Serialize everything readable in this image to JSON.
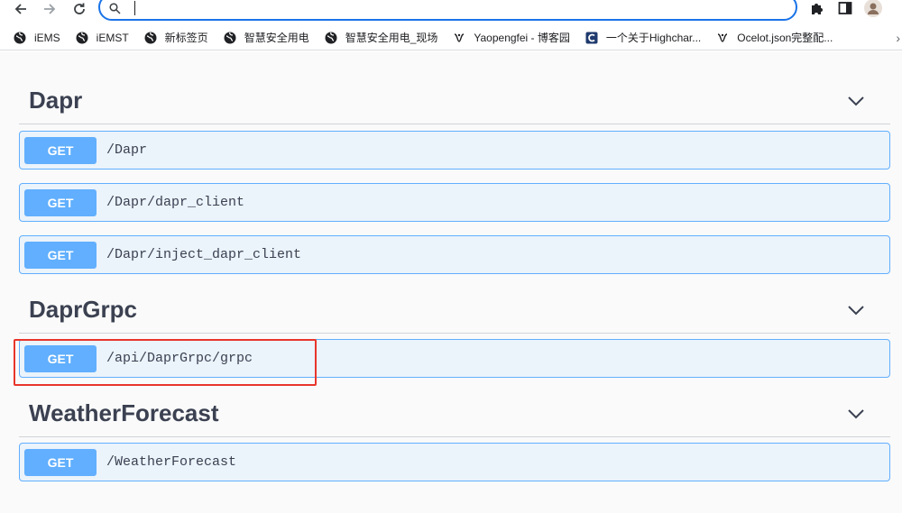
{
  "browser": {
    "address_value": "",
    "bookmarks": [
      {
        "label": "iEMS",
        "icon": "globe-icon"
      },
      {
        "label": "iEMST",
        "icon": "globe-icon"
      },
      {
        "label": "新标签页",
        "icon": "globe-icon"
      },
      {
        "label": "智慧安全用电",
        "icon": "globe-icon"
      },
      {
        "label": "智慧安全用电_现场",
        "icon": "globe-icon"
      },
      {
        "label": "Yaopengfei - 博客园",
        "icon": "cnblogs-icon"
      },
      {
        "label": "一个关于Highchar...",
        "icon": "csdn-icon"
      },
      {
        "label": "Ocelot.json完整配...",
        "icon": "cnblogs-icon"
      }
    ],
    "more_label": "›"
  },
  "sections": [
    {
      "title": "Dapr",
      "operations": [
        {
          "method": "GET",
          "path": "/Dapr"
        },
        {
          "method": "GET",
          "path": "/Dapr/dapr_client"
        },
        {
          "method": "GET",
          "path": "/Dapr/inject_dapr_client"
        }
      ]
    },
    {
      "title": "DaprGrpc",
      "operations": [
        {
          "method": "GET",
          "path": "/api/DaprGrpc/grpc"
        }
      ]
    },
    {
      "title": "WeatherForecast",
      "operations": [
        {
          "method": "GET",
          "path": "/WeatherForecast"
        }
      ]
    }
  ],
  "colors": {
    "get_method": "#61affe",
    "op_background": "#ebf3fb",
    "highlight_box": "#e8352b",
    "title_text": "#3b4151"
  }
}
